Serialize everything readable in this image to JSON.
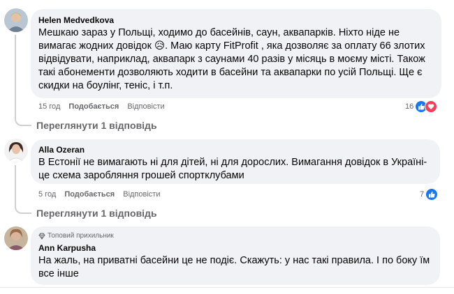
{
  "comments": [
    {
      "author": "Helen Medvedkova",
      "text_part1": "Мешкаю зараз у Польщі, ходимо до басейнів, саун, аквапарків. Ніхто ніде не вимагає жодних довідок ",
      "emoji": "😥",
      "text_part2": ". Маю карту FitProfit , яка дозволяє за оплату 66 злотих відвідувати, наприклад, аквапарк з саунами 40 разів у місяць в моєму місті. Також такі абонементи дозволяють ходити в басейни та аквапарки по усій Польщі. Ще є скидки на боулінг, теніс, і т.п.",
      "time": "15 год",
      "like_label": "Подобається",
      "reply_label": "Відповісти",
      "reaction_count": "16",
      "view_replies": "Переглянути 1 відповідь"
    },
    {
      "author": "Alla Ozeran",
      "text": "В Естонії не вимагають ні для дітей, ні для дорослих. Вимагання довідок в Україні- це схема заробляння грошей спортклубами",
      "time": "5 год",
      "like_label": "Подобається",
      "reply_label": "Відповісти",
      "reaction_count": "7",
      "view_replies": "Переглянути 1 відповідь"
    },
    {
      "badge": "Топовий прихильник",
      "author": "Ann Karpusha",
      "text": "На жаль, на приватні басейни це не подіє. Скажуть: у нас такі правила. І по боку їм все інше"
    }
  ]
}
